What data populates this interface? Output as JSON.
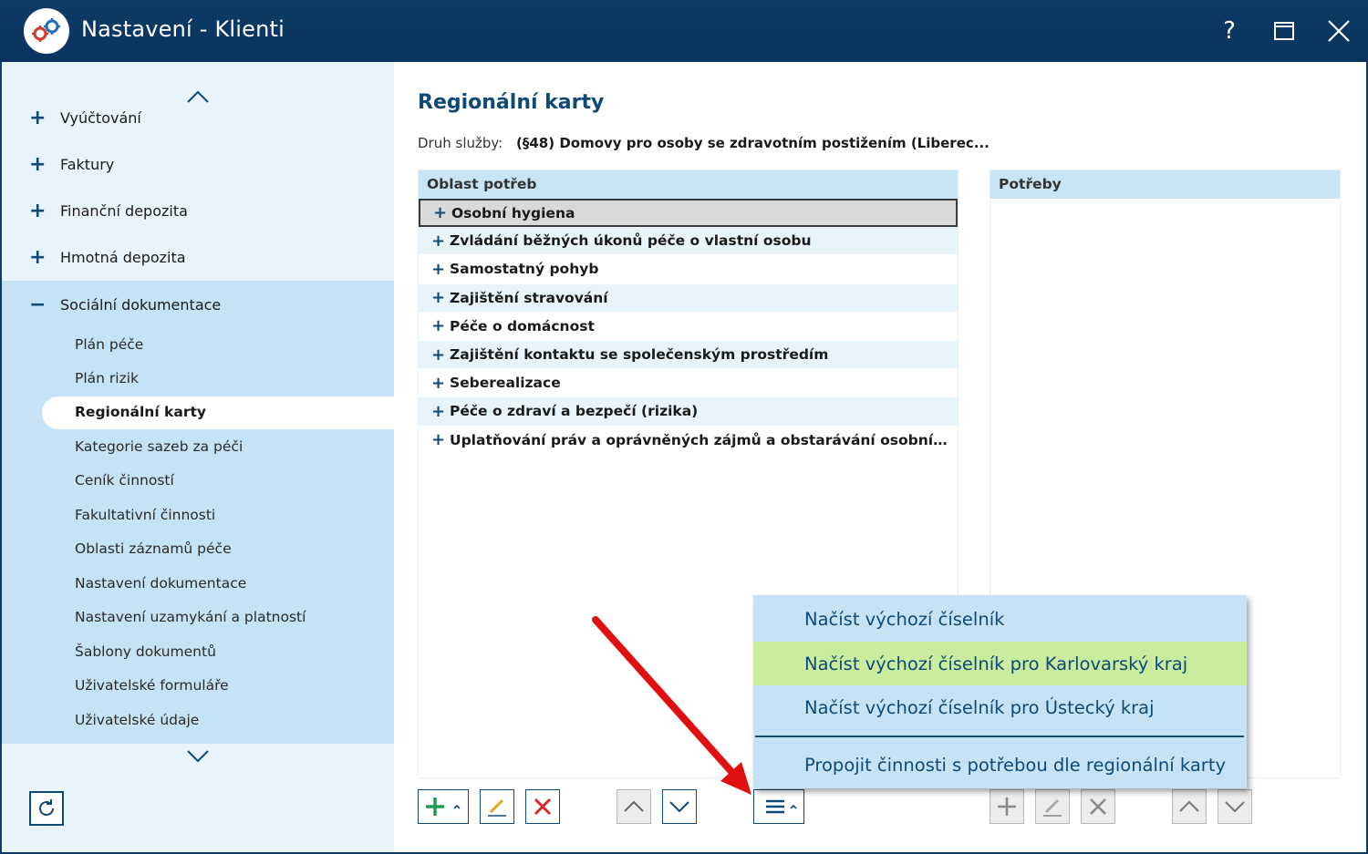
{
  "window": {
    "title": "Nastavení - Klienti",
    "help_label": "?"
  },
  "sidebar": {
    "items": [
      {
        "sign": "+",
        "label": "Vyúčtování"
      },
      {
        "sign": "+",
        "label": "Faktury"
      },
      {
        "sign": "+",
        "label": "Finanční depozita"
      },
      {
        "sign": "+",
        "label": "Hmotná depozita"
      },
      {
        "sign": "−",
        "label": "Sociální dokumentace"
      }
    ],
    "subitems": [
      "Plán péče",
      "Plán rizik",
      "Regionální karty",
      "Kategorie sazeb za péči",
      "Ceník činností",
      "Fakultativní činnosti",
      "Oblasti záznamů péče",
      "Nastavení dokumentace",
      "Nastavení uzamykání a platností",
      "Šablony dokumentů",
      "Uživatelské formuláře",
      "Uživatelské údaje"
    ],
    "active_subitem": "Regionální karty"
  },
  "main": {
    "title": "Regionální karty",
    "service_label": "Druh služby:",
    "service_value": "(§48) Domovy pro osoby se zdravotním postižením (Liberec...",
    "left_panel": {
      "header": "Oblast potřeb",
      "rows": [
        "Osobní hygiena",
        "Zvládání běžných úkonů péče o vlastní osobu",
        "Samostatný pohyb",
        "Zajištění stravování",
        "Péče o domácnost",
        "Zajištění kontaktu se společenským prostředím",
        "Seberealizace",
        "Péče o zdraví a bezpečí (rizika)",
        "Uplatňování práv a oprávněných zájmů a obstarávání osobních zál..."
      ]
    },
    "right_panel": {
      "header": "Potřeby"
    }
  },
  "menu": {
    "items": [
      "Načíst výchozí číselník",
      "Načíst výchozí číselník pro Karlovarský kraj",
      "Načíst výchozí číselník pro Ústecký kraj",
      "Propojit činnosti s potřebou dle regionální karty"
    ],
    "highlighted": "Načíst výchozí číselník pro Karlovarský kraj"
  },
  "icons": {
    "add": "plus-icon",
    "edit": "pencil-icon",
    "delete": "x-icon",
    "up": "chevron-up-icon",
    "down": "chevron-down-icon",
    "menu": "hamburger-icon",
    "refresh": "refresh-icon"
  },
  "colors": {
    "titlebar": "#0d3a66",
    "accent": "#0e4a75",
    "sidebar_bg": "#e8f4fc",
    "sidebar_section": "#c6e3f5",
    "menu_highlight": "#c9ec9f",
    "add_green": "#1e9b52",
    "delete_red": "#d52b2b",
    "arrow_red": "#e01010"
  }
}
